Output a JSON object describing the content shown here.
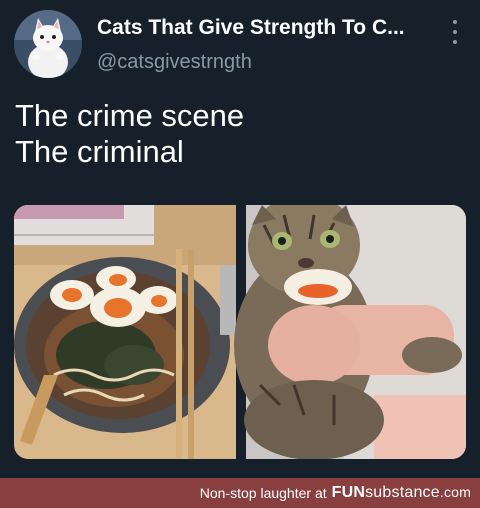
{
  "tweet": {
    "display_name": "Cats That Give Strength To C...",
    "handle": "@catsgivestrngth",
    "lines": [
      "The crime scene",
      "The criminal"
    ],
    "more_icon": "more-vertical-icon",
    "media": [
      {
        "subject": "bowl of ramen with halved soft-boiled eggs and chopsticks"
      },
      {
        "subject": "tabby cat holding half a boiled egg in its mouth"
      }
    ]
  },
  "footer": {
    "tagline": "Non-stop laughter at",
    "brand_bold": "FUN",
    "brand_rest": "substance",
    "brand_domain": ".com",
    "background": "#8a3f3f"
  },
  "colors": {
    "background": "#15202b",
    "text": "#ffffff",
    "secondary": "#8899a6"
  }
}
